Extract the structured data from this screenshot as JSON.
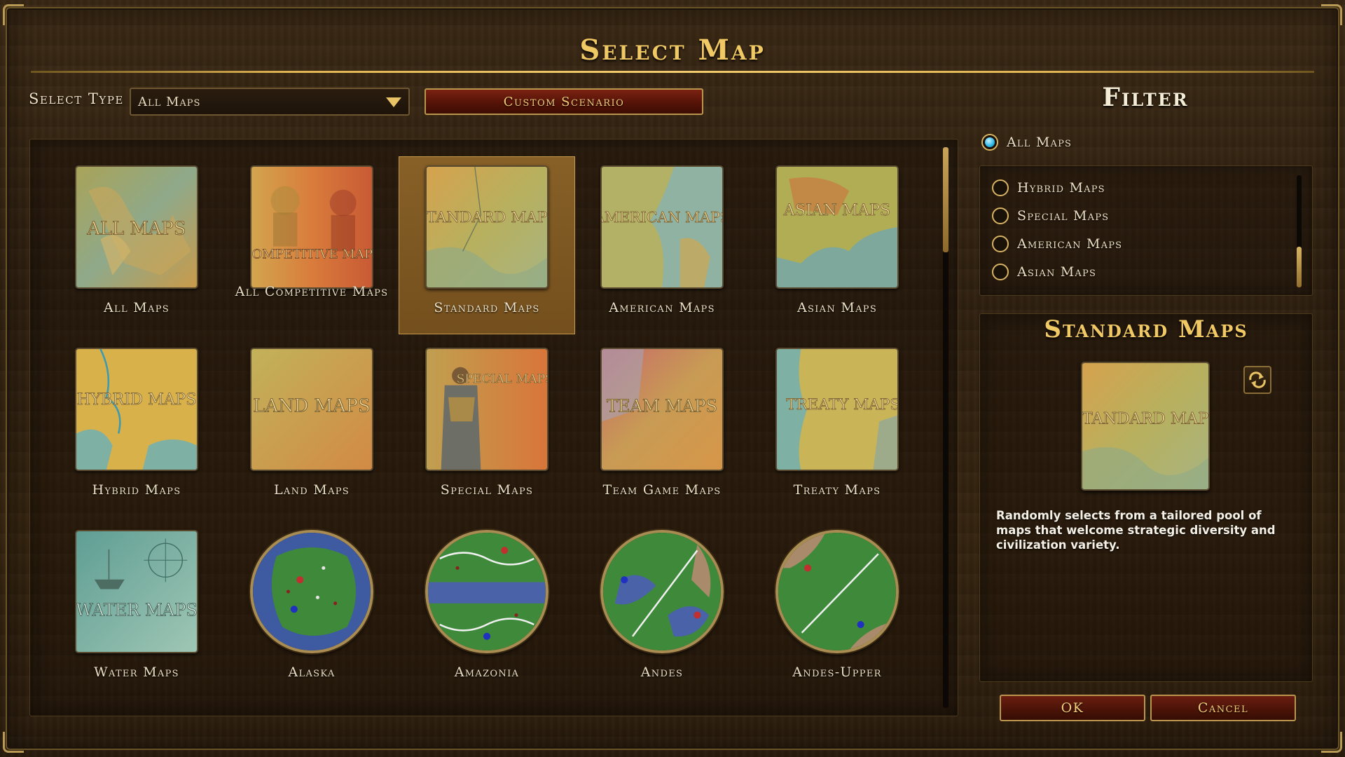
{
  "title": "Select Map",
  "select_type": {
    "label": "Select Type",
    "value": "All Maps"
  },
  "custom_scenario_label": "Custom Scenario",
  "grid": {
    "tiles": [
      {
        "label": "All Maps",
        "thumb_text": "ALL MAPS"
      },
      {
        "label": "All Competitive Maps",
        "thumb_text": "COMPETITIVE MAPS"
      },
      {
        "label": "Standard Maps",
        "thumb_text": "STANDARD MAPS",
        "selected": true
      },
      {
        "label": "American Maps",
        "thumb_text": "AMERICAN MAPS"
      },
      {
        "label": "Asian Maps",
        "thumb_text": "ASIAN MAPS"
      },
      {
        "label": "Hybrid Maps",
        "thumb_text": "HYBRID MAPS"
      },
      {
        "label": "Land Maps",
        "thumb_text": "LAND MAPS"
      },
      {
        "label": "Special Maps",
        "thumb_text": "SPECIAL MAPS"
      },
      {
        "label": "Team Game Maps",
        "thumb_text": "TEAM MAPS"
      },
      {
        "label": "Treaty Maps",
        "thumb_text": "TREATY MAPS"
      },
      {
        "label": "Water Maps",
        "thumb_text": "WATER MAPS"
      },
      {
        "label": "Alaska"
      },
      {
        "label": "Amazonia"
      },
      {
        "label": "Andes"
      },
      {
        "label": "Andes-Upper"
      }
    ]
  },
  "filter": {
    "title": "Filter",
    "top_option": {
      "label": "All Maps",
      "selected": true
    },
    "options": [
      {
        "label": "Hybrid Maps",
        "selected": false
      },
      {
        "label": "Special Maps",
        "selected": false
      },
      {
        "label": "American Maps",
        "selected": false
      },
      {
        "label": "Asian Maps",
        "selected": false
      }
    ]
  },
  "detail": {
    "title": "Standard Maps",
    "thumb_text": "STANDARD MAPS",
    "description": "Randomly selects from a tailored pool of maps that welcome strategic diversity and civilization variety."
  },
  "buttons": {
    "ok": "OK",
    "cancel": "Cancel"
  },
  "colors": {
    "gold": "#f0c864",
    "radio_on": "#29b6e6",
    "button_red": "#5a1609"
  }
}
